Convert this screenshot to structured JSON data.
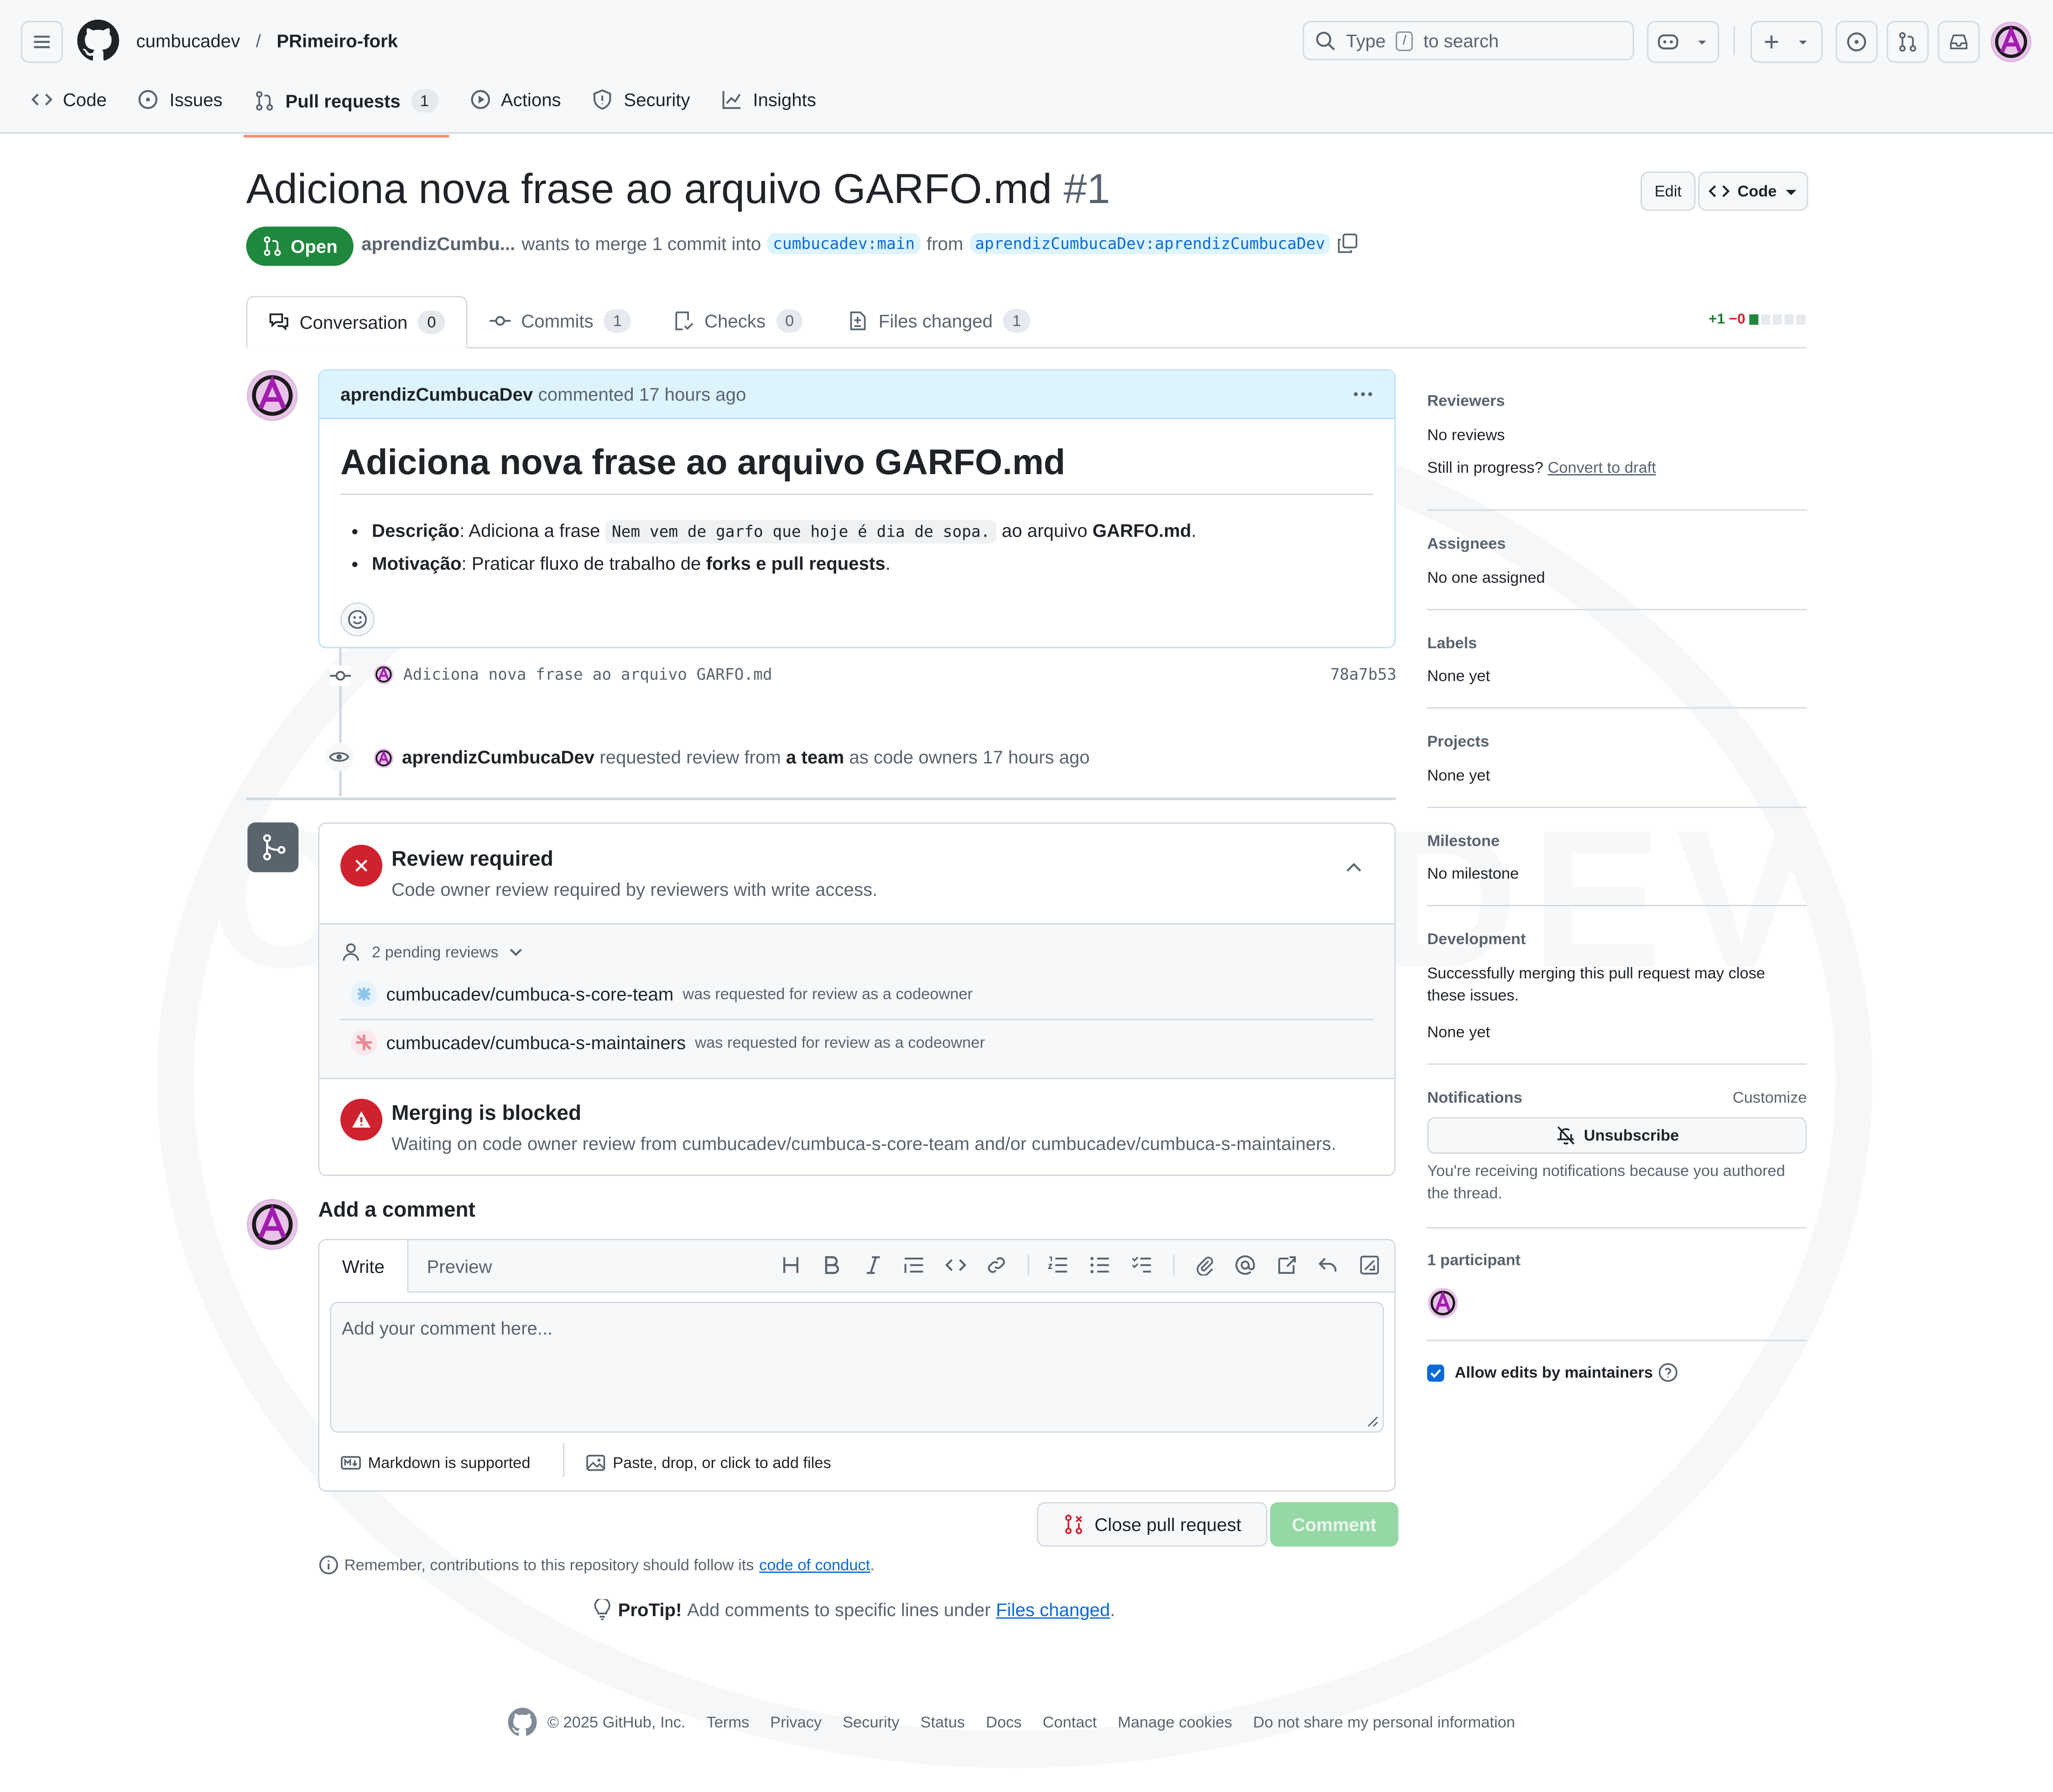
{
  "header": {
    "owner": "cumbucadev",
    "separator": "/",
    "repo": "PRimeiro-fork",
    "search_placeholder_pre": "Type",
    "search_key": "/",
    "search_placeholder_post": "to search"
  },
  "repo_nav": [
    {
      "label": "Code",
      "icon": "code-icon"
    },
    {
      "label": "Issues",
      "icon": "issue-opened-icon"
    },
    {
      "label": "Pull requests",
      "icon": "git-pull-request-icon",
      "count": "1",
      "selected": true
    },
    {
      "label": "Actions",
      "icon": "play-icon"
    },
    {
      "label": "Security",
      "icon": "shield-icon"
    },
    {
      "label": "Insights",
      "icon": "graph-icon"
    }
  ],
  "pr": {
    "title": "Adiciona nova frase ao arquivo GARFO.md",
    "number": "#1",
    "edit_label": "Edit",
    "code_label": "Code",
    "state": "Open",
    "author": "aprendizCumbu...",
    "merge_text": "wants to merge 1 commit into",
    "base_branch": "cumbucadev:main",
    "from_text": "from",
    "head_branch": "aprendizCumbucaDev:aprendizCumbucaDev"
  },
  "tabs": [
    {
      "label": "Conversation",
      "count": "0"
    },
    {
      "label": "Commits",
      "count": "1"
    },
    {
      "label": "Checks",
      "count": "0"
    },
    {
      "label": "Files changed",
      "count": "1"
    }
  ],
  "diffstat": {
    "add": "+1",
    "del": "−0"
  },
  "comment": {
    "author": "aprendizCumbucaDev",
    "when": "commented 17 hours ago",
    "heading": "Adiciona nova frase ao arquivo GARFO.md",
    "item1_label": "Descrição",
    "item1_text": ": Adiciona a frase",
    "item1_code": "Nem vem de garfo que hoje é dia de sopa.",
    "item1_tail": "ao arquivo",
    "item1_file": "GARFO.md",
    "item1_end": ".",
    "item2_label": "Motivação",
    "item2_text": ": Praticar fluxo de trabalho de",
    "item2_bold": "forks e pull requests",
    "item2_end": "."
  },
  "timeline": {
    "commit_msg": "Adiciona nova frase ao arquivo GARFO.md",
    "commit_sha": "78a7b53",
    "review_author": "aprendizCumbucaDev",
    "review_text": "requested review from",
    "review_team": "a team",
    "review_tail": "as code owners 17 hours ago"
  },
  "merge_box": {
    "review_title": "Review required",
    "review_sub": "Code owner review required by reviewers with write access.",
    "pending": "2 pending reviews",
    "reviewers": [
      {
        "name": "cumbucadev/cumbuca-s-core-team",
        "note": "was requested for review as a codeowner"
      },
      {
        "name": "cumbucadev/cumbuca-s-maintainers",
        "note": "was requested for review as a codeowner"
      }
    ],
    "blocked_title": "Merging is blocked",
    "blocked_sub": "Waiting on code owner review from cumbucadev/cumbuca-s-core-team and/or cumbucadev/cumbuca-s-maintainers."
  },
  "new_comment": {
    "heading": "Add a comment",
    "write_tab": "Write",
    "preview_tab": "Preview",
    "placeholder": "Add your comment here...",
    "markdown": "Markdown is supported",
    "attach": "Paste, drop, or click to add files",
    "close_label": "Close pull request",
    "comment_label": "Comment",
    "conduct_pre": "Remember, contributions to this repository should follow its",
    "conduct_link": "code of conduct",
    "conduct_end": ".",
    "protip_label": "ProTip!",
    "protip_text": "Add comments to specific lines under",
    "protip_link": "Files changed",
    "protip_end": "."
  },
  "sidebar": {
    "reviewers_h": "Reviewers",
    "reviewers_v": "No reviews",
    "progress_pre": "Still in progress?",
    "progress_link": "Convert to draft",
    "assignees_h": "Assignees",
    "assignees_v": "No one assigned",
    "labels_h": "Labels",
    "labels_v": "None yet",
    "projects_h": "Projects",
    "projects_v": "None yet",
    "milestone_h": "Milestone",
    "milestone_v": "No milestone",
    "development_h": "Development",
    "development_text": "Successfully merging this pull request may close these issues.",
    "development_v": "None yet",
    "notifications_h": "Notifications",
    "customize": "Customize",
    "unsubscribe": "Unsubscribe",
    "notif_reason": "You're receiving notifications because you authored the thread.",
    "participants_h": "1 participant",
    "allow_edits": "Allow edits by maintainers"
  },
  "footer": {
    "copyright": "© 2025 GitHub, Inc.",
    "links": [
      "Terms",
      "Privacy",
      "Security",
      "Status",
      "Docs",
      "Contact",
      "Manage cookies",
      "Do not share my personal information"
    ]
  },
  "watermark": "CUMBUCA DEV",
  "colors": {
    "accent": "#0969da",
    "open_green": "#1f883d",
    "danger": "#cf222e",
    "selected_tab": "#fd8c73"
  }
}
